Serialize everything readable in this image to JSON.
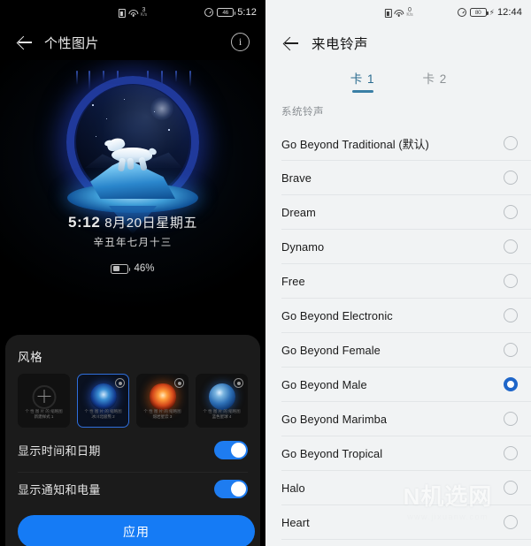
{
  "left": {
    "status": {
      "sim_icon": "sim-card-icon",
      "wifi_icon": "wifi-icon",
      "net_speed": "3",
      "net_unit": "K/s",
      "alarm_icon": "alarm-icon",
      "battery_level": "46",
      "time": "5:12"
    },
    "header": {
      "back_icon": "back-arrow-icon",
      "title": "个性图片",
      "info_icon": "info-icon"
    },
    "lockscreen": {
      "time": "5:12",
      "date": "8月20日星期五",
      "lunar": "辛丑年七月十三",
      "battery_icon": "battery-icon",
      "battery_percent": "46%"
    },
    "style": {
      "title": "风格",
      "thumbs": [
        {
          "name": "add-style-thumb",
          "kind": "add",
          "selected": false,
          "caption_top": "个 性 图 片 的 缩略图",
          "caption_bottom": "新建样式 1"
        },
        {
          "name": "style-thumb-polar-bear",
          "kind": "blue",
          "selected": true,
          "caption_top": "个 性 图 片 的 缩略图",
          "caption_bottom": "冰川北极熊 2"
        },
        {
          "name": "style-thumb-fire",
          "kind": "fire",
          "selected": false,
          "caption_top": "个 性 图 片 的 缩略图",
          "caption_bottom": "熔岩星云 3"
        },
        {
          "name": "style-thumb-earth",
          "kind": "earth",
          "selected": false,
          "caption_top": "个 性 图 片 的 缩略图",
          "caption_bottom": "蓝色星球 4"
        }
      ]
    },
    "toggles": [
      {
        "label": "显示时间和日期",
        "on": true
      },
      {
        "label": "显示通知和电量",
        "on": true
      }
    ],
    "apply_label": "应用"
  },
  "right": {
    "status": {
      "sim_icon": "sim-card-icon",
      "wifi_icon": "wifi-icon",
      "net_speed": "0",
      "net_unit": "K/s",
      "alarm_icon": "alarm-icon",
      "battery_level": "80",
      "charging_icon": "charging-bolt-icon",
      "time": "12:44"
    },
    "header": {
      "back_icon": "back-arrow-icon",
      "title": "来电铃声"
    },
    "tabs": [
      {
        "label": "卡 1",
        "active": true
      },
      {
        "label": "卡 2",
        "active": false
      }
    ],
    "section_label": "系统铃声",
    "ringtones": [
      {
        "name": "Go Beyond Traditional (默认)",
        "selected": false
      },
      {
        "name": "Brave",
        "selected": false
      },
      {
        "name": "Dream",
        "selected": false
      },
      {
        "name": "Dynamo",
        "selected": false
      },
      {
        "name": "Free",
        "selected": false
      },
      {
        "name": "Go Beyond Electronic",
        "selected": false
      },
      {
        "name": "Go Beyond Female",
        "selected": false
      },
      {
        "name": "Go Beyond Male",
        "selected": true
      },
      {
        "name": "Go Beyond Marimba",
        "selected": false
      },
      {
        "name": "Go Beyond Tropical",
        "selected": false
      },
      {
        "name": "Halo",
        "selected": false
      },
      {
        "name": "Heart",
        "selected": false
      }
    ],
    "watermark": {
      "main": "N机选网",
      "sub": "www.jixuanw.com"
    }
  },
  "colors": {
    "accent_blue": "#157bf5",
    "tab_blue": "#3a7fa5",
    "radio_blue": "#1f66c9",
    "left_bg": "#000000",
    "right_bg": "#f1f3f4"
  }
}
